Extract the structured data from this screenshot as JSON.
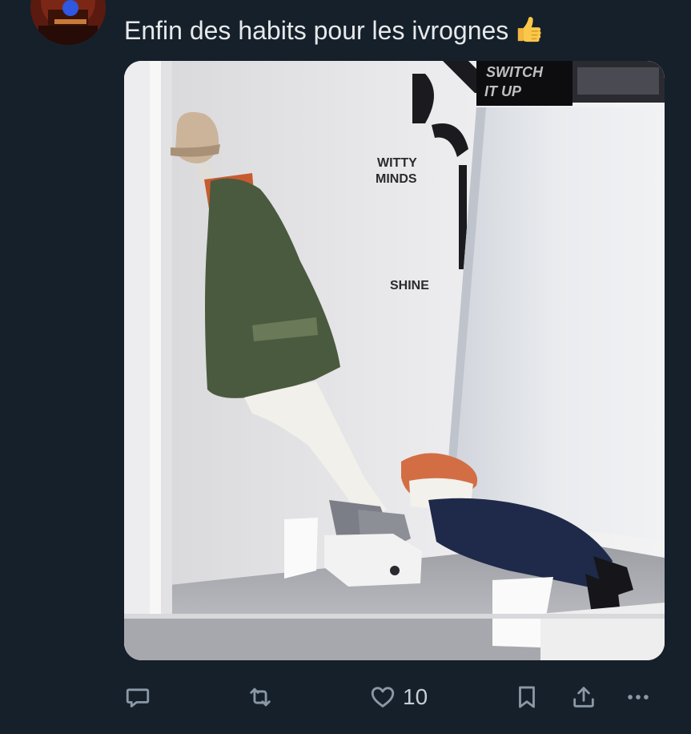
{
  "tweet": {
    "text": "Enfin des habits pour les ivrognes",
    "emoji": "thumbs-up-emoji"
  },
  "media": {
    "store_signs": [
      "SWITCH",
      "IT UP",
      "WITTY",
      "MINDS",
      "SHINE"
    ]
  },
  "actions": {
    "reply_icon": "reply-icon",
    "retweet_icon": "retweet-icon",
    "like_icon": "heart-icon",
    "like_count": "10",
    "bookmark_icon": "bookmark-icon",
    "share_icon": "share-icon",
    "more_icon": "more-icon"
  },
  "colors": {
    "background": "#15202b",
    "text": "#e7e9ea",
    "muted": "#8b98a5"
  }
}
